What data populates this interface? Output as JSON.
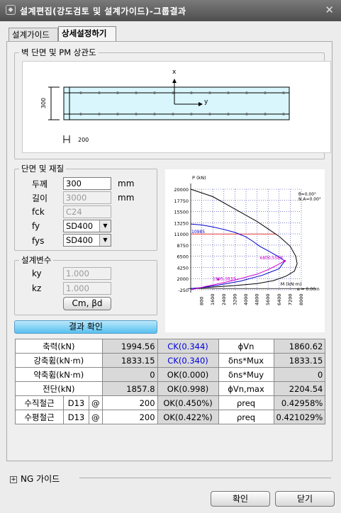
{
  "window": {
    "title": "설계편집(강도검토 및 설계가이드)-그룹결과",
    "close_icon": "close-icon"
  },
  "tabs": [
    {
      "label": "설계가이드"
    },
    {
      "label": "상세설정하기"
    }
  ],
  "section_view": {
    "legend": "벽 단면 및 PM 상관도",
    "dim_height": "300",
    "dim_spacing": "200",
    "axis_x": "x",
    "axis_y": "y"
  },
  "material": {
    "legend": "단면 및 재질",
    "thickness_label": "두께",
    "thickness_value": "300",
    "thickness_unit": "mm",
    "length_label": "길이",
    "length_value": "3000",
    "length_unit": "mm",
    "fck_label": "fck",
    "fck_value": "C24",
    "fy_label": "fy",
    "fy_value": "SD400",
    "fys_label": "fys",
    "fys_value": "SD400"
  },
  "design_vars": {
    "legend": "설계변수",
    "ky_label": "ky",
    "ky_value": "1.000",
    "kz_label": "kz",
    "kz_value": "1.000",
    "cm_button": "Cm, βd"
  },
  "result_button": "결과 확인",
  "chart_data": {
    "type": "line",
    "y_axis_label": "P (kN)",
    "x_axis_label": "M (kN·m)",
    "y_ticks": [
      "20000",
      "17750",
      "15500",
      "13250",
      "11000",
      "8750",
      "6500",
      "4250",
      "2000",
      "-250"
    ],
    "x_ticks": [
      "800",
      "1600",
      "2400",
      "3200",
      "4000",
      "4800",
      "5600",
      "6400",
      "7200",
      "8000"
    ],
    "ylim": [
      -250,
      20000
    ],
    "xlim": [
      0,
      8000
    ],
    "legend_text": [
      "θ=0.00°",
      "N.A=0.00°"
    ],
    "zero_label": "e = 0.00m",
    "red_label": "10985",
    "point_labels": [
      "1995,1833",
      "6800,5568"
    ],
    "series": [
      {
        "color": "#000000",
        "x": [
          0,
          1600,
          3200,
          4800,
          6400,
          7200,
          7600,
          7700,
          7500,
          6900,
          6000,
          4800,
          3200,
          1600,
          0
        ],
        "y": [
          20000,
          18500,
          16000,
          13500,
          10500,
          8500,
          6500,
          5000,
          3500,
          2500,
          1600,
          1000,
          600,
          300,
          0
        ]
      },
      {
        "color": "#0000cc",
        "x": [
          0,
          800,
          1600,
          2400,
          3200,
          4000,
          4500,
          5000,
          5600,
          6300,
          6800,
          6400,
          5200,
          3600,
          2000,
          800,
          0
        ],
        "y": [
          13000,
          12800,
          12400,
          11900,
          11300,
          10400,
          9500,
          8500,
          7600,
          6500,
          5568,
          4000,
          2700,
          1500,
          700,
          200,
          0
        ]
      },
      {
        "color": "#cc00cc",
        "x": [
          0,
          1200,
          2400,
          3600,
          4800,
          5600,
          6300,
          6800
        ],
        "y": [
          -250,
          500,
          1200,
          2000,
          2900,
          3800,
          4800,
          5568
        ]
      }
    ]
  },
  "results": {
    "rows": [
      {
        "label": "축력(kN)",
        "value": "1994.56",
        "check": "CK(0.344)",
        "check_blue": true,
        "label2": "ϕVn",
        "value2": "1860.62"
      },
      {
        "label": "강축휨(kN·m)",
        "value": "1833.15",
        "check": "CK(0.340)",
        "check_blue": true,
        "label2": "δns*Mux",
        "value2": "1833.15"
      },
      {
        "label": "약축휨(kN·m)",
        "value": "0",
        "check": "OK(0.000)",
        "check_blue": false,
        "label2": "δns*Muy",
        "value2": "0"
      },
      {
        "label": "전단(kN)",
        "value": "1857.8",
        "check": "OK(0.998)",
        "check_blue": false,
        "label2": "ϕVn,max",
        "value2": "2204.54"
      }
    ],
    "rebar": [
      {
        "label": "수직철근",
        "bar": "D13",
        "at": "@",
        "spacing": "200",
        "check": "OK(0.450%)",
        "req_label": "ρreq",
        "req_value": "0.42958%"
      },
      {
        "label": "수평철근",
        "bar": "D13",
        "at": "@",
        "spacing": "200",
        "check": "OK(0.422%)",
        "req_label": "ρreq",
        "req_value": "0.421029%"
      }
    ]
  },
  "ng_guide": {
    "label": "NG 가이드",
    "expand_icon": "plus-box-icon"
  },
  "footer": {
    "ok": "확인",
    "close": "닫기"
  }
}
